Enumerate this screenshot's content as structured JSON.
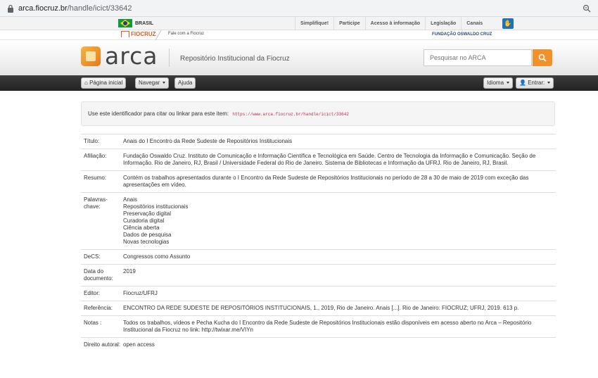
{
  "browser": {
    "url_host": "arca.fiocruz.br",
    "url_path": "/handle/icict/33642"
  },
  "govbar": {
    "country": "BRASIL",
    "links": [
      "Simplifique!",
      "Participe",
      "Acesso à informação",
      "Legislação",
      "Canais"
    ]
  },
  "fiobar": {
    "logo": "FIOCRUZ",
    "contact": "Fale com a Fiocruz",
    "foundation": "FUNDAÇÃO OSWALDO CRUZ"
  },
  "header": {
    "logo_text": "arca",
    "subtitle": "Repositório Institucional da Fiocruz",
    "search_placeholder": "Pesquisar no ARCA"
  },
  "nav": {
    "home": "Página inicial",
    "browse": "Navegar",
    "help": "Ajuda",
    "language": "Idioma",
    "login": "Entrar:"
  },
  "identifier": {
    "label": "Use este identificador para citar ou linkar para este item:",
    "value": "https://www.arca.fiocruz.br/handle/icict/33642"
  },
  "colors": {
    "accent": "#f0912b",
    "navbar": "#2b2b2b",
    "identifier": "#c7254e"
  },
  "metadata": [
    {
      "label": "Título:",
      "value": [
        "Anais do I Encontro da Rede Sudeste de Repositórios Institucionais"
      ]
    },
    {
      "label": "Afiliação:",
      "value": [
        "Fundação Oswaldo Cruz. Instituto de Comunicação e Informação Científica e Tecnológica em Saúde. Centro de Tecnologia da Informação e Comunicação. Seção de Informação. Rio de Janeiro, RJ, Brasil / Universidade Federal do Rio de Janeiro. Sistema de Bibliotecas e Informação da UFRJ. Rio de Janeiro, RJ, Brasil."
      ]
    },
    {
      "label": "Resumo:",
      "value": [
        "Contém os trabalhos apresentados durante o I Encontro da Rede Sudeste de Repositórios Institucionais no período de 28 a 30 de maio de 2019 com exceção das apresentações em vídeo."
      ]
    },
    {
      "label": "Palavras-chave:",
      "value": [
        "Anais",
        "Repositórios institucionais",
        "Preservação digital",
        "Curadoria digital",
        "Ciência aberta",
        "Dados de pesquisa",
        "Novas tecnologias"
      ]
    },
    {
      "label": "DeCS:",
      "value": [
        "Congressos como Assunto"
      ]
    },
    {
      "label": "Data do documento:",
      "value": [
        "2019"
      ]
    },
    {
      "label": "Editor:",
      "value": [
        "Fiocruz/UFRJ"
      ]
    },
    {
      "label": "Referência:",
      "value": [
        "ENCONTRO DA REDE SUDESTE DE REPOSITÓRIOS INSTITUCIONAIS, 1., 2019, Rio de Janeiro. Anais [...]. Rio de Janeiro: FIOCRUZ; UFRJ, 2019. 613 p."
      ]
    },
    {
      "label": "Notas :",
      "value": [
        "Todos os trabalhos, vídeos e Pecha Kucha do I Encontro da Rede Sudeste de Repositórios Institucionais estão disponíveis em acesso aberto no Arca – Repositório Institucional da Fiocruz no link: http://twixar.me/VIYn"
      ]
    },
    {
      "label": "Direito autoral:",
      "value": [
        "open access"
      ]
    }
  ]
}
